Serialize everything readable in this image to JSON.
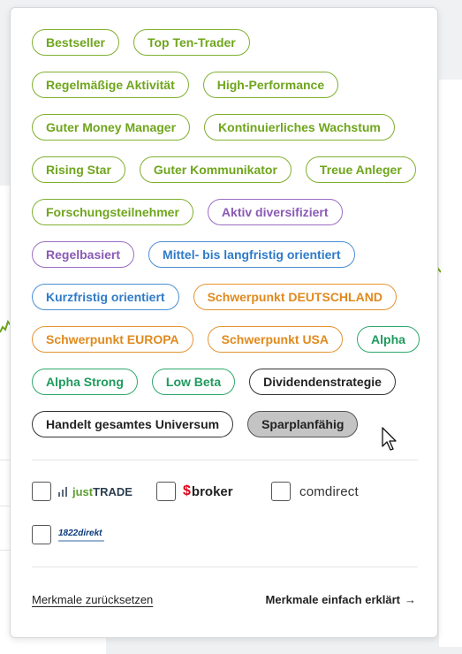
{
  "filters": {
    "chips": [
      {
        "label": "Bestseller",
        "color": "green",
        "selected": false
      },
      {
        "label": "Top Ten-Trader",
        "color": "green",
        "selected": false
      },
      {
        "label": "Regelmäßige Aktivität",
        "color": "green",
        "selected": false
      },
      {
        "label": "High-Performance",
        "color": "green",
        "selected": false
      },
      {
        "label": "Guter Money Manager",
        "color": "green",
        "selected": false
      },
      {
        "label": "Kontinuierliches Wachstum",
        "color": "green",
        "selected": false
      },
      {
        "label": "Rising Star",
        "color": "green",
        "selected": false
      },
      {
        "label": "Guter Kommunikator",
        "color": "green",
        "selected": false
      },
      {
        "label": "Treue Anleger",
        "color": "green",
        "selected": false
      },
      {
        "label": "Forschungsteilnehmer",
        "color": "green",
        "selected": false
      },
      {
        "label": "Aktiv diversifiziert",
        "color": "purple",
        "selected": false
      },
      {
        "label": "Regelbasiert",
        "color": "purple",
        "selected": false
      },
      {
        "label": "Mittel- bis langfristig orientiert",
        "color": "blue",
        "selected": false
      },
      {
        "label": "Kurzfristig orientiert",
        "color": "blue",
        "selected": false
      },
      {
        "label": "Schwerpunkt DEUTSCHLAND",
        "color": "orange",
        "selected": false
      },
      {
        "label": "Schwerpunkt EUROPA",
        "color": "orange",
        "selected": false
      },
      {
        "label": "Schwerpunkt USA",
        "color": "orange",
        "selected": false
      },
      {
        "label": "Alpha",
        "color": "teal",
        "selected": false
      },
      {
        "label": "Alpha Strong",
        "color": "teal",
        "selected": false
      },
      {
        "label": "Low Beta",
        "color": "teal",
        "selected": false
      },
      {
        "label": "Dividendenstrategie",
        "color": "dark",
        "selected": false
      },
      {
        "label": "Handelt gesamtes Universum",
        "color": "dark",
        "selected": false
      },
      {
        "label": "Sparplanfähig",
        "color": "dark",
        "selected": true
      }
    ]
  },
  "brokers": {
    "justtrade": {
      "part1": "just",
      "part2": "TRADE",
      "checked": false
    },
    "sbroker": {
      "symbol": "$",
      "text": "broker",
      "checked": false
    },
    "comdirect": {
      "text": "comdirect",
      "checked": false
    },
    "direkt1822": {
      "text": "1822direkt",
      "checked": false
    }
  },
  "footer": {
    "reset_prefix": "Merkmale ",
    "reset_bold": "zurücksetzen",
    "explain_label": "Merkmale einfach erklärt",
    "explain_arrow": "→"
  },
  "colors": {
    "green": "#6fa51c",
    "purple": "#8a5ab5",
    "blue": "#2f7bc8",
    "orange": "#e08a1e",
    "teal": "#1f9a5e",
    "dark": "#222222",
    "selected_bg": "#c4c4c4"
  }
}
